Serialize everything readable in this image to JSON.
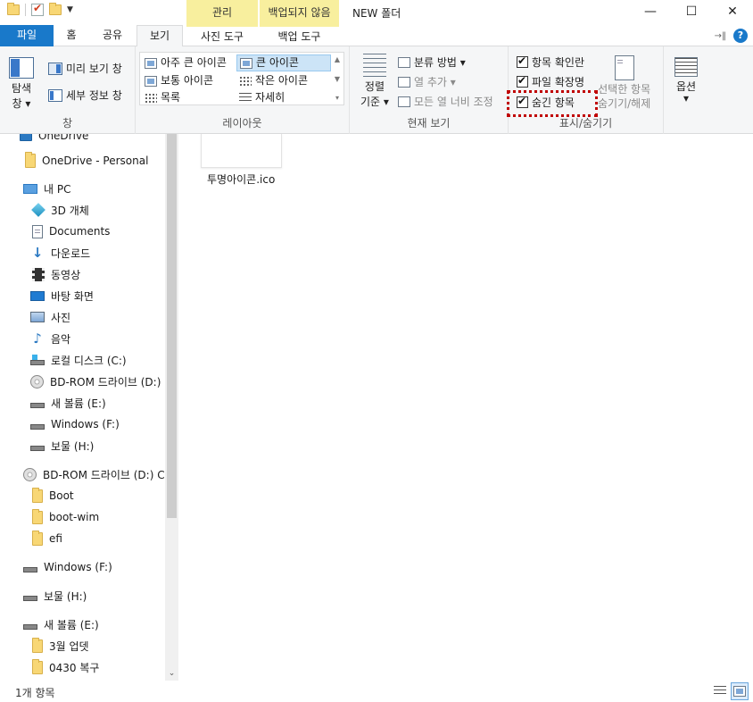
{
  "window": {
    "title": "NEW 폴더",
    "context_tab_manage": "관리",
    "context_tab_backup": "백업되지 않음",
    "minimize": "—",
    "maximize": "☐",
    "close": "✕"
  },
  "tabs": {
    "file": "파일",
    "home": "홈",
    "share": "공유",
    "view": "보기",
    "picture_tools": "사진 도구",
    "backup_tools": "백업 도구",
    "help": "?"
  },
  "ribbon": {
    "pane": {
      "nav_pane_line1": "탐색",
      "nav_pane_line2": "창 ▾",
      "preview_pane": "미리 보기 창",
      "details_pane": "세부 정보 창",
      "label": "창"
    },
    "layout": {
      "items": [
        "아주 큰 아이콘",
        "큰 아이콘",
        "보통 아이콘",
        "작은 아이콘",
        "목록",
        "자세히"
      ],
      "selected": "큰 아이콘",
      "label": "레이아웃"
    },
    "current_view": {
      "sort_line1": "정렬",
      "sort_line2": "기준 ▾",
      "group_by": "분류 방법 ▾",
      "add_columns": "열 추가 ▾",
      "size_all_columns": "모든 열 너비 조정",
      "label": "현재 보기"
    },
    "show_hide": {
      "item_checkboxes": "항목 확인란",
      "file_extensions": "파일 확장명",
      "hidden_items": "숨긴 항목",
      "hide_selected_line1": "선택한 항목",
      "hide_selected_line2": "숨기기/해제",
      "label": "표시/숨기기",
      "checked": [
        true,
        true,
        true
      ]
    },
    "options": {
      "label_line1": "옵션",
      "label_line2": "▾"
    }
  },
  "nav": {
    "items": [
      {
        "label": "OneDrive",
        "icon": "cloud-icon"
      },
      {
        "label": "OneDrive - Personal",
        "icon": "folder-icon"
      },
      {
        "label": "내 PC",
        "icon": "pc-icon"
      },
      {
        "label": "3D 개체",
        "icon": "cube-icon"
      },
      {
        "label": "Documents",
        "icon": "document-icon"
      },
      {
        "label": "다운로드",
        "icon": "download-icon"
      },
      {
        "label": "동영상",
        "icon": "video-icon"
      },
      {
        "label": "바탕 화면",
        "icon": "desktop-icon"
      },
      {
        "label": "사진",
        "icon": "pictures-icon"
      },
      {
        "label": "음악",
        "icon": "music-icon"
      },
      {
        "label": "로컬 디스크 (C:)",
        "icon": "windows-drive-icon"
      },
      {
        "label": "BD-ROM 드라이브 (D:)",
        "icon": "disc-icon"
      },
      {
        "label": "새 볼륨 (E:)",
        "icon": "drive-icon"
      },
      {
        "label": "Windows (F:)",
        "icon": "drive-icon"
      },
      {
        "label": "보물 (H:)",
        "icon": "drive-icon"
      },
      {
        "label": "BD-ROM 드라이브 (D:) C",
        "icon": "disc-icon"
      },
      {
        "label": "Boot",
        "icon": "folder-icon"
      },
      {
        "label": "boot-wim",
        "icon": "folder-icon"
      },
      {
        "label": "efi",
        "icon": "folder-icon"
      },
      {
        "label": "Windows (F:)",
        "icon": "drive-icon"
      },
      {
        "label": "보물 (H:)",
        "icon": "drive-icon"
      },
      {
        "label": "새 볼륨 (E:)",
        "icon": "drive-icon"
      },
      {
        "label": "3월 업뎃",
        "icon": "folder-icon"
      },
      {
        "label": "0430 복구",
        "icon": "folder-icon"
      }
    ]
  },
  "content": {
    "file_name": "투명아이콘.ico"
  },
  "status": {
    "item_count": "1개 항목"
  }
}
